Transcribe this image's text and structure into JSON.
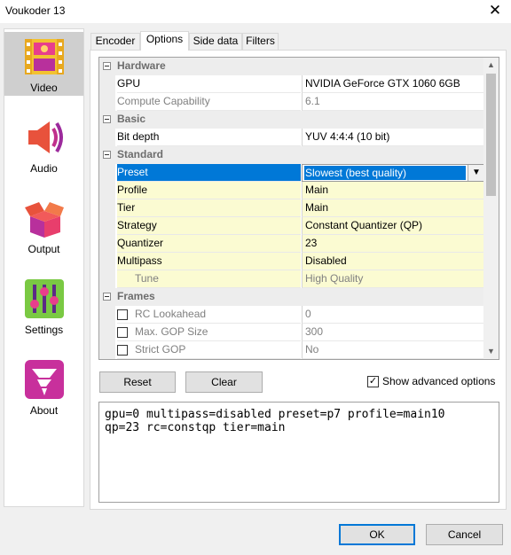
{
  "window": {
    "title": "Voukoder 13",
    "close_glyph": "✕"
  },
  "sidebar": {
    "items": [
      {
        "label": "Video",
        "icon": "film-icon"
      },
      {
        "label": "Audio",
        "icon": "speaker-icon"
      },
      {
        "label": "Output",
        "icon": "package-icon"
      },
      {
        "label": "Settings",
        "icon": "sliders-icon"
      },
      {
        "label": "About",
        "icon": "tornado-icon"
      }
    ]
  },
  "tabs": [
    "Encoder",
    "Options",
    "Side data",
    "Filters"
  ],
  "grid": {
    "categories": {
      "hardware": "Hardware",
      "basic": "Basic",
      "standard": "Standard",
      "frames": "Frames"
    },
    "rows": {
      "gpu": {
        "name": "GPU",
        "value": "NVIDIA GeForce GTX 1060 6GB"
      },
      "compute": {
        "name": "Compute Capability",
        "value": "6.1"
      },
      "bitdepth": {
        "name": "Bit depth",
        "value": "YUV 4:4:4 (10 bit)"
      },
      "preset": {
        "name": "Preset",
        "value": "Slowest (best quality)"
      },
      "profile": {
        "name": "Profile",
        "value": "Main"
      },
      "tier": {
        "name": "Tier",
        "value": "Main"
      },
      "strategy": {
        "name": "Strategy",
        "value": "Constant Quantizer (QP)"
      },
      "quantizer": {
        "name": "Quantizer",
        "value": "23"
      },
      "multipass": {
        "name": "Multipass",
        "value": "Disabled"
      },
      "tune": {
        "name": "Tune",
        "value": "High Quality"
      },
      "lookahead": {
        "name": "RC Lookahead",
        "value": "0"
      },
      "gop": {
        "name": "Max. GOP Size",
        "value": "300"
      },
      "strictgop": {
        "name": "Strict GOP",
        "value": "No"
      }
    }
  },
  "buttons": {
    "reset": "Reset",
    "clear": "Clear",
    "ok": "OK",
    "cancel": "Cancel"
  },
  "advanced": {
    "label": "Show advanced options",
    "checked": true,
    "check_glyph": "✓"
  },
  "output_text": "gpu=0 multipass=disabled preset=p7 profile=main10\nqp=23 rc=constqp tier=main",
  "colors": {
    "accent": "#0078d7",
    "highlight_row": "#fbfbd2"
  }
}
